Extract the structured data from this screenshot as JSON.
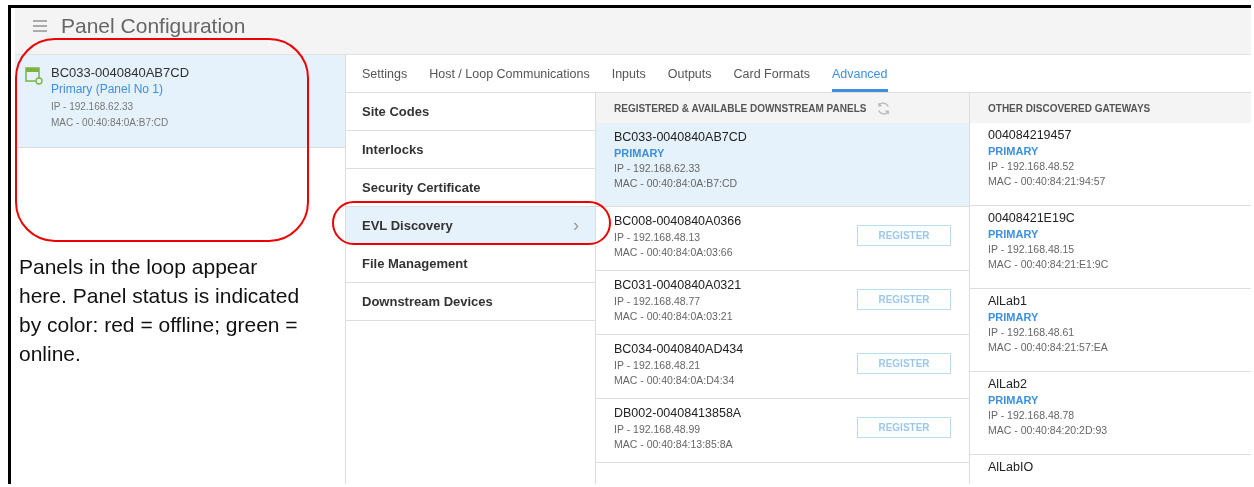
{
  "header": {
    "title": "Panel Configuration"
  },
  "panels": [
    {
      "name": "BC033-0040840AB7CD",
      "color": "#7cb342",
      "subtitle": "Primary (Panel No 1)",
      "ip": "IP - 192.168.62.33",
      "mac": "MAC - 00:40:84:0A:B7:CD",
      "selected": true
    }
  ],
  "tabs": [
    {
      "label": "Settings",
      "selected": false
    },
    {
      "label": "Host / Loop Communications",
      "selected": false
    },
    {
      "label": "Inputs",
      "selected": false
    },
    {
      "label": "Outputs",
      "selected": false
    },
    {
      "label": "Card Formats",
      "selected": false
    },
    {
      "label": "Advanced",
      "selected": true
    }
  ],
  "menu": [
    {
      "label": "Site Codes",
      "selected": false
    },
    {
      "label": "Interlocks",
      "selected": false
    },
    {
      "label": "Security Certificate",
      "selected": false
    },
    {
      "label": "EVL Discovery",
      "selected": true,
      "chevron": "›"
    },
    {
      "label": "File Management",
      "selected": false
    },
    {
      "label": "Downstream Devices",
      "selected": false
    }
  ],
  "downstream": {
    "title": "REGISTERED & AVAILABLE DOWNSTREAM PANELS",
    "panels": [
      {
        "name": "BC033-0040840AB7CD",
        "role": "PRIMARY",
        "ip": "IP - 192.168.62.33",
        "mac": "MAC - 00:40:84:0A:B7:CD",
        "selected": true
      },
      {
        "name": "BC008-0040840A0366",
        "ip": "IP - 192.168.48.13",
        "mac": "MAC - 00:40:84:0A:03:66",
        "button": "REGISTER",
        "selected": false
      },
      {
        "name": "BC031-0040840A0321",
        "ip": "IP - 192.168.48.77",
        "mac": "MAC - 00:40:84:0A:03:21",
        "button": "REGISTER",
        "selected": false
      },
      {
        "name": "BC034-0040840AD434",
        "ip": "IP - 192.168.48.21",
        "mac": "MAC - 00:40:84:0A:D4:34",
        "button": "REGISTER",
        "selected": false
      },
      {
        "name": "DB002-00408413858A",
        "ip": "IP - 192.168.48.99",
        "mac": "MAC - 00:40:84:13:85:8A",
        "button": "REGISTER",
        "selected": false
      }
    ]
  },
  "gateways": {
    "title": "OTHER DISCOVERED GATEWAYS",
    "items": [
      {
        "name": "004084219457",
        "role": "PRIMARY",
        "ip": "IP - 192.168.48.52",
        "mac": "MAC - 00:40:84:21:94:57"
      },
      {
        "name": "00408421E19C",
        "role": "PRIMARY",
        "ip": "IP - 192.168.48.15",
        "mac": "MAC - 00:40:84:21:E1:9C"
      },
      {
        "name": "AlLab1",
        "role": "PRIMARY",
        "ip": "IP - 192.168.48.61",
        "mac": "MAC - 00:40:84:21:57:EA"
      },
      {
        "name": "AlLab2",
        "role": "PRIMARY",
        "ip": "IP - 192.168.48.78",
        "mac": "MAC - 00:40:84:20:2D:93"
      },
      {
        "name": "AlLabIO"
      }
    ]
  },
  "annotation": {
    "note": "Panels in the loop appear here. Panel status is indicated by color: red = offline; green = online."
  }
}
